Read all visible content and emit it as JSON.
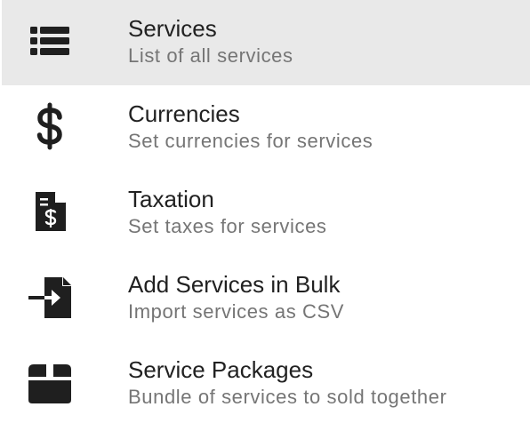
{
  "menu": {
    "items": [
      {
        "icon": "list-icon",
        "title": "Services",
        "subtitle": "List of all services",
        "selected": true
      },
      {
        "icon": "dollar-icon",
        "title": "Currencies",
        "subtitle": "Set currencies for services",
        "selected": false
      },
      {
        "icon": "invoice-dollar-icon",
        "title": "Taxation",
        "subtitle": "Set taxes for services",
        "selected": false
      },
      {
        "icon": "file-import-icon",
        "title": "Add Services in Bulk",
        "subtitle": "Import services as CSV",
        "selected": false
      },
      {
        "icon": "box-icon",
        "title": "Service Packages",
        "subtitle": "Bundle of services to sold together",
        "selected": false
      }
    ]
  },
  "colors": {
    "selected_background": "#e9e9e9",
    "title": "#212121",
    "subtitle": "#757575",
    "icon": "#1f1f1f"
  }
}
